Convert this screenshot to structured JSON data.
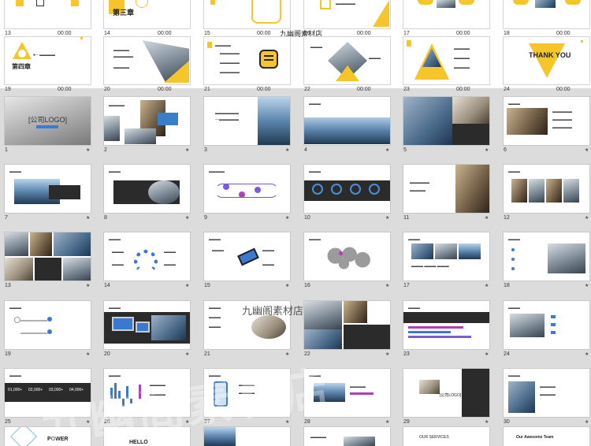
{
  "top_rows": [
    {
      "num": "13",
      "time": "00:00"
    },
    {
      "num": "14",
      "time": "00:00"
    },
    {
      "num": "15",
      "time": "00:00"
    },
    {
      "num": "16",
      "time": "00:00"
    },
    {
      "num": "17",
      "time": "00:00"
    },
    {
      "num": "18",
      "time": "00:00"
    },
    {
      "num": "19",
      "time": "00:00"
    },
    {
      "num": "20",
      "time": "00:00"
    },
    {
      "num": "21",
      "time": "00:00"
    },
    {
      "num": "22",
      "time": "00:00"
    },
    {
      "num": "23",
      "time": "00:00"
    },
    {
      "num": "24",
      "time": "00:00"
    }
  ],
  "chapter3_title": "第三章",
  "chapter4_title": "第四章",
  "thank_you": "THANK YOU",
  "watermark": "九幽阁素材店",
  "watermark_overlay": "九幽阁素材店",
  "logo_text": "[公司LOGO]",
  "slides": [
    "1",
    "2",
    "3",
    "4",
    "5",
    "6",
    "7",
    "8",
    "9",
    "10",
    "11",
    "12",
    "13",
    "14",
    "15",
    "16",
    "17",
    "18",
    "19",
    "20",
    "21",
    "22",
    "23",
    "24",
    "25",
    "26",
    "27",
    "28",
    "29",
    "30"
  ],
  "slide_texts": {
    "s25_stats": [
      "01,000+",
      "02,000+",
      "03,000+",
      "04,000+"
    ],
    "power": "POWER",
    "hello": "HELLO",
    "our_services": "OUR SERVICES",
    "awesome_team": "Our Awesome Team"
  }
}
